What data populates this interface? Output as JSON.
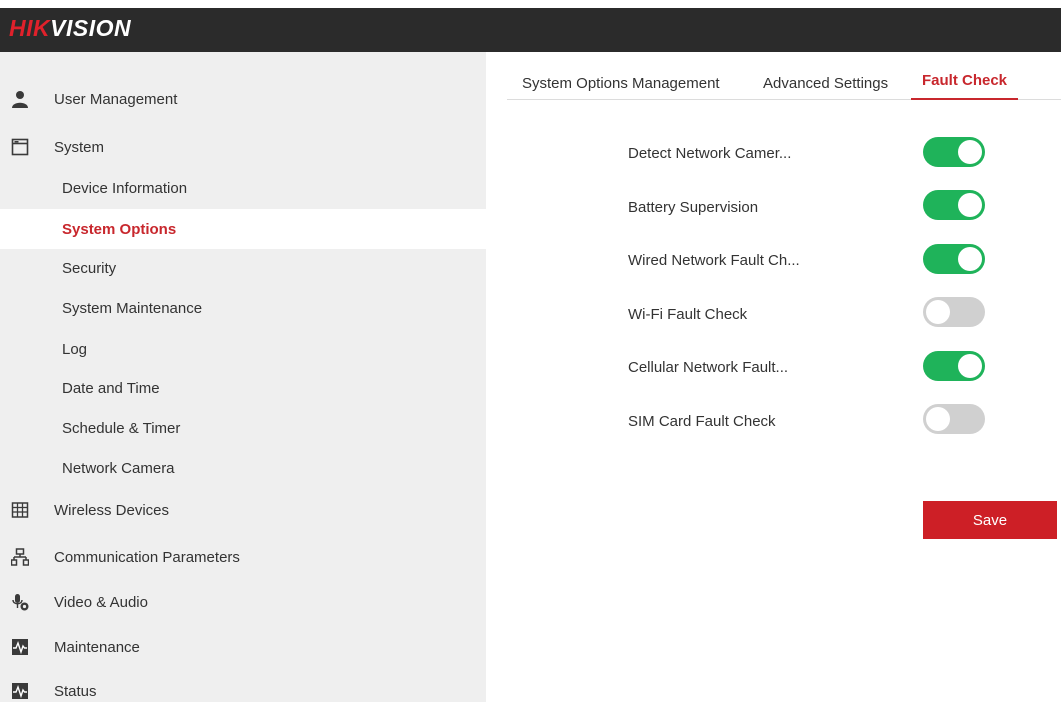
{
  "header": {
    "logo_red": "HIK",
    "logo_white": "VISION",
    "brand_color": "#e0212b"
  },
  "sidebar": {
    "items": [
      {
        "label": "User Management",
        "icon": "user-icon"
      },
      {
        "label": "System",
        "icon": "window-icon"
      },
      {
        "label": "Device Information"
      },
      {
        "label": "System Options",
        "active": true
      },
      {
        "label": "Security"
      },
      {
        "label": "System Maintenance"
      },
      {
        "label": "Log"
      },
      {
        "label": "Date and Time"
      },
      {
        "label": "Schedule & Timer"
      },
      {
        "label": "Network Camera"
      },
      {
        "label": "Wireless Devices",
        "icon": "grid-icon"
      },
      {
        "label": "Communication Parameters",
        "icon": "network-icon"
      },
      {
        "label": "Video & Audio",
        "icon": "video-audio-icon"
      },
      {
        "label": "Maintenance",
        "icon": "pulse-icon"
      },
      {
        "label": "Status",
        "icon": "pulse-icon"
      }
    ]
  },
  "tabs": [
    {
      "label": "System Options Management",
      "active": false
    },
    {
      "label": "Advanced Settings",
      "active": false
    },
    {
      "label": "Fault Check",
      "active": true
    }
  ],
  "fault_check": {
    "rows": [
      {
        "label": "Detect Network Camer...",
        "enabled": true
      },
      {
        "label": "Battery Supervision",
        "enabled": true
      },
      {
        "label": "Wired Network Fault Ch...",
        "enabled": true
      },
      {
        "label": "Wi-Fi Fault Check",
        "enabled": false
      },
      {
        "label": "Cellular Network Fault...",
        "enabled": true
      },
      {
        "label": "SIM Card Fault Check",
        "enabled": false
      }
    ],
    "save_label": "Save"
  },
  "colors": {
    "accent": "#c8272d",
    "toggle_on": "#1fb35a",
    "toggle_off": "#d0d0d0",
    "save_button": "#cd1f26"
  }
}
